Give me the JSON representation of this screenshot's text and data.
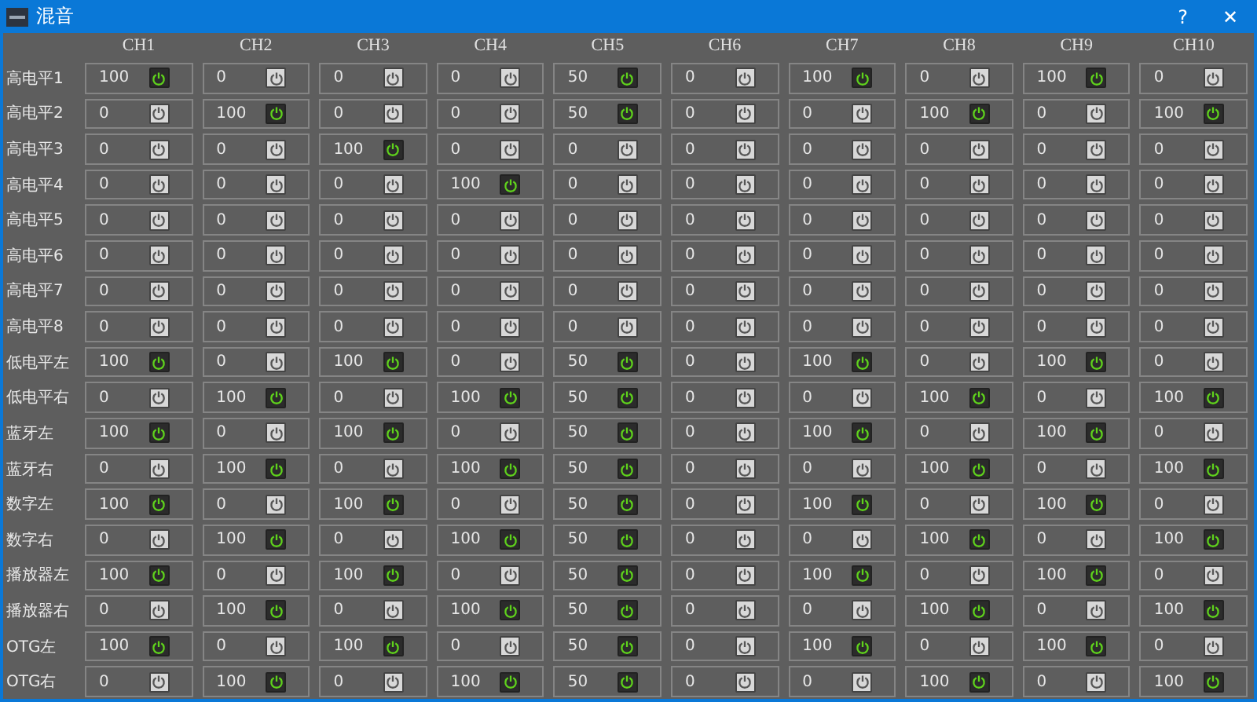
{
  "window": {
    "title": "混音",
    "help_button": "?",
    "close_button": "✕"
  },
  "columns": [
    "CH1",
    "CH2",
    "CH3",
    "CH4",
    "CH5",
    "CH6",
    "CH7",
    "CH8",
    "CH9",
    "CH10"
  ],
  "rows": [
    {
      "label": "高电平1",
      "cells": [
        {
          "value": "100",
          "on": true
        },
        {
          "value": "0",
          "on": false
        },
        {
          "value": "0",
          "on": false
        },
        {
          "value": "0",
          "on": false
        },
        {
          "value": "50",
          "on": true
        },
        {
          "value": "0",
          "on": false
        },
        {
          "value": "100",
          "on": true
        },
        {
          "value": "0",
          "on": false
        },
        {
          "value": "100",
          "on": true
        },
        {
          "value": "0",
          "on": false
        }
      ]
    },
    {
      "label": "高电平2",
      "cells": [
        {
          "value": "0",
          "on": false
        },
        {
          "value": "100",
          "on": true
        },
        {
          "value": "0",
          "on": false
        },
        {
          "value": "0",
          "on": false
        },
        {
          "value": "50",
          "on": true
        },
        {
          "value": "0",
          "on": false
        },
        {
          "value": "0",
          "on": false
        },
        {
          "value": "100",
          "on": true
        },
        {
          "value": "0",
          "on": false
        },
        {
          "value": "100",
          "on": true
        }
      ]
    },
    {
      "label": "高电平3",
      "cells": [
        {
          "value": "0",
          "on": false
        },
        {
          "value": "0",
          "on": false
        },
        {
          "value": "100",
          "on": true
        },
        {
          "value": "0",
          "on": false
        },
        {
          "value": "0",
          "on": false
        },
        {
          "value": "0",
          "on": false
        },
        {
          "value": "0",
          "on": false
        },
        {
          "value": "0",
          "on": false
        },
        {
          "value": "0",
          "on": false
        },
        {
          "value": "0",
          "on": false
        }
      ]
    },
    {
      "label": "高电平4",
      "cells": [
        {
          "value": "0",
          "on": false
        },
        {
          "value": "0",
          "on": false
        },
        {
          "value": "0",
          "on": false
        },
        {
          "value": "100",
          "on": true
        },
        {
          "value": "0",
          "on": false
        },
        {
          "value": "0",
          "on": false
        },
        {
          "value": "0",
          "on": false
        },
        {
          "value": "0",
          "on": false
        },
        {
          "value": "0",
          "on": false
        },
        {
          "value": "0",
          "on": false
        }
      ]
    },
    {
      "label": "高电平5",
      "cells": [
        {
          "value": "0",
          "on": false
        },
        {
          "value": "0",
          "on": false
        },
        {
          "value": "0",
          "on": false
        },
        {
          "value": "0",
          "on": false
        },
        {
          "value": "0",
          "on": false
        },
        {
          "value": "0",
          "on": false
        },
        {
          "value": "0",
          "on": false
        },
        {
          "value": "0",
          "on": false
        },
        {
          "value": "0",
          "on": false
        },
        {
          "value": "0",
          "on": false
        }
      ]
    },
    {
      "label": "高电平6",
      "cells": [
        {
          "value": "0",
          "on": false
        },
        {
          "value": "0",
          "on": false
        },
        {
          "value": "0",
          "on": false
        },
        {
          "value": "0",
          "on": false
        },
        {
          "value": "0",
          "on": false
        },
        {
          "value": "0",
          "on": false
        },
        {
          "value": "0",
          "on": false
        },
        {
          "value": "0",
          "on": false
        },
        {
          "value": "0",
          "on": false
        },
        {
          "value": "0",
          "on": false
        }
      ]
    },
    {
      "label": "高电平7",
      "cells": [
        {
          "value": "0",
          "on": false
        },
        {
          "value": "0",
          "on": false
        },
        {
          "value": "0",
          "on": false
        },
        {
          "value": "0",
          "on": false
        },
        {
          "value": "0",
          "on": false
        },
        {
          "value": "0",
          "on": false
        },
        {
          "value": "0",
          "on": false
        },
        {
          "value": "0",
          "on": false
        },
        {
          "value": "0",
          "on": false
        },
        {
          "value": "0",
          "on": false
        }
      ]
    },
    {
      "label": "高电平8",
      "cells": [
        {
          "value": "0",
          "on": false
        },
        {
          "value": "0",
          "on": false
        },
        {
          "value": "0",
          "on": false
        },
        {
          "value": "0",
          "on": false
        },
        {
          "value": "0",
          "on": false
        },
        {
          "value": "0",
          "on": false
        },
        {
          "value": "0",
          "on": false
        },
        {
          "value": "0",
          "on": false
        },
        {
          "value": "0",
          "on": false
        },
        {
          "value": "0",
          "on": false
        }
      ]
    },
    {
      "label": "低电平左",
      "cells": [
        {
          "value": "100",
          "on": true
        },
        {
          "value": "0",
          "on": false
        },
        {
          "value": "100",
          "on": true
        },
        {
          "value": "0",
          "on": false
        },
        {
          "value": "50",
          "on": true
        },
        {
          "value": "0",
          "on": false
        },
        {
          "value": "100",
          "on": true
        },
        {
          "value": "0",
          "on": false
        },
        {
          "value": "100",
          "on": true
        },
        {
          "value": "0",
          "on": false
        }
      ]
    },
    {
      "label": "低电平右",
      "cells": [
        {
          "value": "0",
          "on": false
        },
        {
          "value": "100",
          "on": true
        },
        {
          "value": "0",
          "on": false
        },
        {
          "value": "100",
          "on": true
        },
        {
          "value": "50",
          "on": true
        },
        {
          "value": "0",
          "on": false
        },
        {
          "value": "0",
          "on": false
        },
        {
          "value": "100",
          "on": true
        },
        {
          "value": "0",
          "on": false
        },
        {
          "value": "100",
          "on": true
        }
      ]
    },
    {
      "label": "蓝牙左",
      "cells": [
        {
          "value": "100",
          "on": true
        },
        {
          "value": "0",
          "on": false
        },
        {
          "value": "100",
          "on": true
        },
        {
          "value": "0",
          "on": false
        },
        {
          "value": "50",
          "on": true
        },
        {
          "value": "0",
          "on": false
        },
        {
          "value": "100",
          "on": true
        },
        {
          "value": "0",
          "on": false
        },
        {
          "value": "100",
          "on": true
        },
        {
          "value": "0",
          "on": false
        }
      ]
    },
    {
      "label": "蓝牙右",
      "cells": [
        {
          "value": "0",
          "on": false
        },
        {
          "value": "100",
          "on": true
        },
        {
          "value": "0",
          "on": false
        },
        {
          "value": "100",
          "on": true
        },
        {
          "value": "50",
          "on": true
        },
        {
          "value": "0",
          "on": false
        },
        {
          "value": "0",
          "on": false
        },
        {
          "value": "100",
          "on": true
        },
        {
          "value": "0",
          "on": false
        },
        {
          "value": "100",
          "on": true
        }
      ]
    },
    {
      "label": "数字左",
      "cells": [
        {
          "value": "100",
          "on": true
        },
        {
          "value": "0",
          "on": false
        },
        {
          "value": "100",
          "on": true
        },
        {
          "value": "0",
          "on": false
        },
        {
          "value": "50",
          "on": true
        },
        {
          "value": "0",
          "on": false
        },
        {
          "value": "100",
          "on": true
        },
        {
          "value": "0",
          "on": false
        },
        {
          "value": "100",
          "on": true
        },
        {
          "value": "0",
          "on": false
        }
      ]
    },
    {
      "label": "数字右",
      "cells": [
        {
          "value": "0",
          "on": false
        },
        {
          "value": "100",
          "on": true
        },
        {
          "value": "0",
          "on": false
        },
        {
          "value": "100",
          "on": true
        },
        {
          "value": "50",
          "on": true
        },
        {
          "value": "0",
          "on": false
        },
        {
          "value": "0",
          "on": false
        },
        {
          "value": "100",
          "on": true
        },
        {
          "value": "0",
          "on": false
        },
        {
          "value": "100",
          "on": true
        }
      ]
    },
    {
      "label": "播放器左",
      "cells": [
        {
          "value": "100",
          "on": true
        },
        {
          "value": "0",
          "on": false
        },
        {
          "value": "100",
          "on": true
        },
        {
          "value": "0",
          "on": false
        },
        {
          "value": "50",
          "on": true
        },
        {
          "value": "0",
          "on": false
        },
        {
          "value": "100",
          "on": true
        },
        {
          "value": "0",
          "on": false
        },
        {
          "value": "100",
          "on": true
        },
        {
          "value": "0",
          "on": false
        }
      ]
    },
    {
      "label": "播放器右",
      "cells": [
        {
          "value": "0",
          "on": false
        },
        {
          "value": "100",
          "on": true
        },
        {
          "value": "0",
          "on": false
        },
        {
          "value": "100",
          "on": true
        },
        {
          "value": "50",
          "on": true
        },
        {
          "value": "0",
          "on": false
        },
        {
          "value": "0",
          "on": false
        },
        {
          "value": "100",
          "on": true
        },
        {
          "value": "0",
          "on": false
        },
        {
          "value": "100",
          "on": true
        }
      ]
    },
    {
      "label": "OTG左",
      "cells": [
        {
          "value": "100",
          "on": true
        },
        {
          "value": "0",
          "on": false
        },
        {
          "value": "100",
          "on": true
        },
        {
          "value": "0",
          "on": false
        },
        {
          "value": "50",
          "on": true
        },
        {
          "value": "0",
          "on": false
        },
        {
          "value": "100",
          "on": true
        },
        {
          "value": "0",
          "on": false
        },
        {
          "value": "100",
          "on": true
        },
        {
          "value": "0",
          "on": false
        }
      ]
    },
    {
      "label": "OTG右",
      "cells": [
        {
          "value": "0",
          "on": false
        },
        {
          "value": "100",
          "on": true
        },
        {
          "value": "0",
          "on": false
        },
        {
          "value": "100",
          "on": true
        },
        {
          "value": "50",
          "on": true
        },
        {
          "value": "0",
          "on": false
        },
        {
          "value": "0",
          "on": false
        },
        {
          "value": "100",
          "on": true
        },
        {
          "value": "0",
          "on": false
        },
        {
          "value": "100",
          "on": true
        }
      ]
    }
  ]
}
